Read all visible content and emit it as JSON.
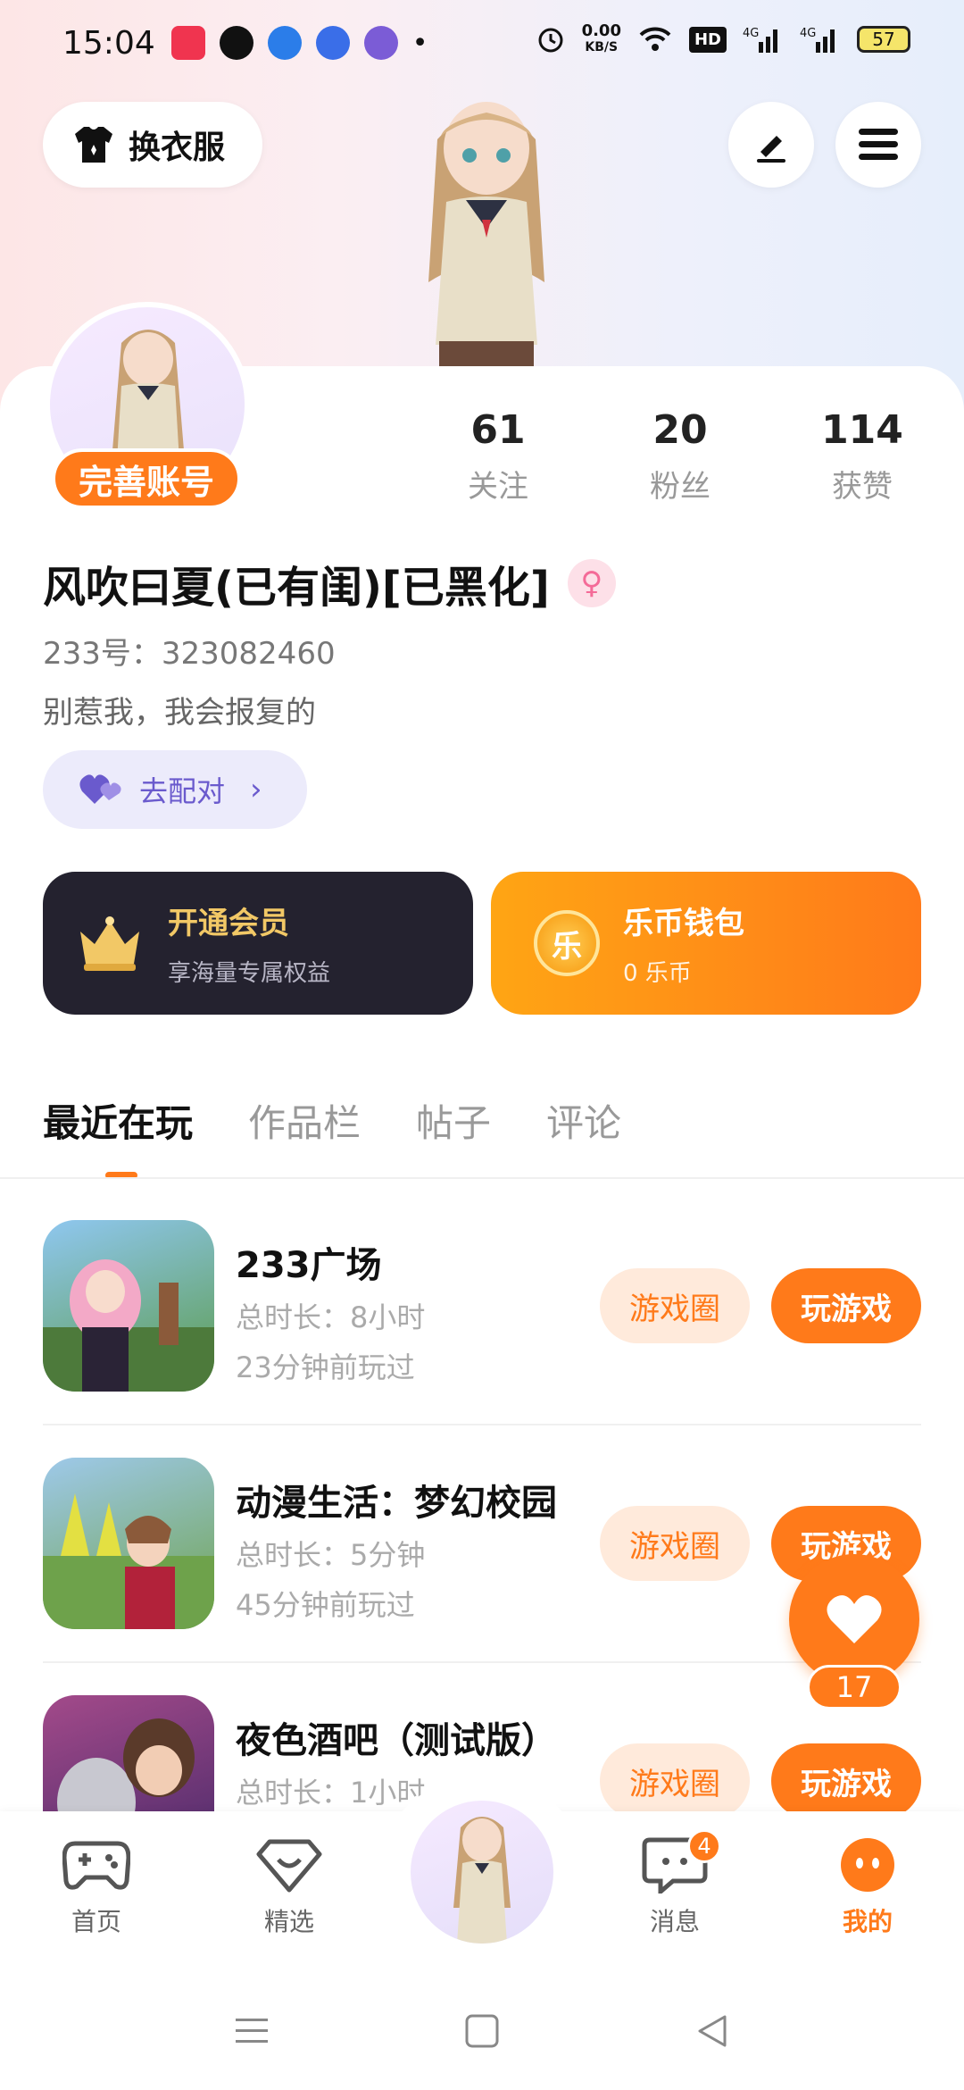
{
  "status_bar": {
    "time": "15:04",
    "speed_value": "0.00",
    "speed_unit": "KB/S",
    "battery": "57"
  },
  "header": {
    "outfit_label": "换衣服"
  },
  "profile": {
    "complete_badge": "完善账号",
    "stats": [
      {
        "value": "61",
        "label": "关注"
      },
      {
        "value": "20",
        "label": "粉丝"
      },
      {
        "value": "114",
        "label": "获赞"
      }
    ],
    "username": "风吹曰夏(已有闺)[已黑化]",
    "uid": "233号：323082460",
    "bio": "别惹我，我会报复的",
    "match_label": "去配对"
  },
  "promo": {
    "vip_title": "开通会员",
    "vip_sub": "享海量专属权益",
    "wallet_title": "乐币钱包",
    "wallet_sub": "0 乐币",
    "coin_glyph": "乐"
  },
  "tabs": [
    "最近在玩",
    "作品栏",
    "帖子",
    "评论"
  ],
  "games": [
    {
      "name": "233广场",
      "duration": "总时长：8小时",
      "last_played": "23分钟前玩过"
    },
    {
      "name": "动漫生活：梦幻校园",
      "duration": "总时长：5分钟",
      "last_played": "45分钟前玩过"
    },
    {
      "name": "夜色酒吧（测试版）",
      "duration": "总时长：1小时",
      "last_played": ""
    }
  ],
  "game_buttons": {
    "circle": "游戏圈",
    "play": "玩游戏"
  },
  "floating": {
    "count": "17"
  },
  "bottom_nav": {
    "items": [
      "首页",
      "精选",
      "消息",
      "我的"
    ],
    "message_badge": "4"
  },
  "colors": {
    "accent": "#ff7a1a",
    "vip_bg": "#24222f",
    "match_bg": "#ecebfb"
  }
}
